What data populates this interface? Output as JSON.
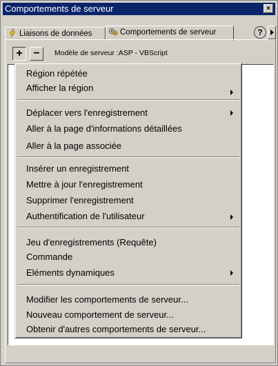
{
  "window": {
    "title": "Comportements de serveur",
    "close_label": "×"
  },
  "tabs": [
    {
      "label": "Liaisons de données",
      "icon": "lightning-icon"
    },
    {
      "label": "Comportements de serveur",
      "icon": "server-behaviors-icon"
    }
  ],
  "help_label": "?",
  "toolbar": {
    "add_label": "+",
    "remove_label": "−",
    "server_model": "Modèle de serveur :ASP - VBScript"
  },
  "menu": {
    "groups": [
      [
        {
          "label": "Région répétée",
          "submenu": false
        },
        {
          "label": "Afficher la région",
          "submenu": true
        }
      ],
      [
        {
          "label": "Déplacer vers l'enregistrement",
          "submenu": true
        },
        {
          "label": "Aller à la page d'informations détaillées",
          "submenu": false
        },
        {
          "label": "Aller à la page associée",
          "submenu": false
        }
      ],
      [
        {
          "label": "Insérer un enregistrement",
          "submenu": false
        },
        {
          "label": "Mettre à jour l'enregistrement",
          "submenu": false
        },
        {
          "label": "Supprimer l'enregistrement",
          "submenu": false
        },
        {
          "label": "Authentification de l'utilisateur",
          "submenu": true
        }
      ],
      [
        {
          "label": "Jeu d'enregistrements (Requête)",
          "submenu": false
        },
        {
          "label": "Commande",
          "submenu": false
        },
        {
          "label": "Eléments dynamiques",
          "submenu": true
        }
      ],
      [
        {
          "label": "Modifier les comportements de serveur...",
          "submenu": false
        },
        {
          "label": "Nouveau comportement de serveur...",
          "submenu": false
        },
        {
          "label": "Obtenir d'autres comportements de serveur...",
          "submenu": false
        }
      ]
    ]
  },
  "colors": {
    "title_bar": "#0a246a",
    "face": "#d4d0c8",
    "lightning": "#f0c000"
  }
}
